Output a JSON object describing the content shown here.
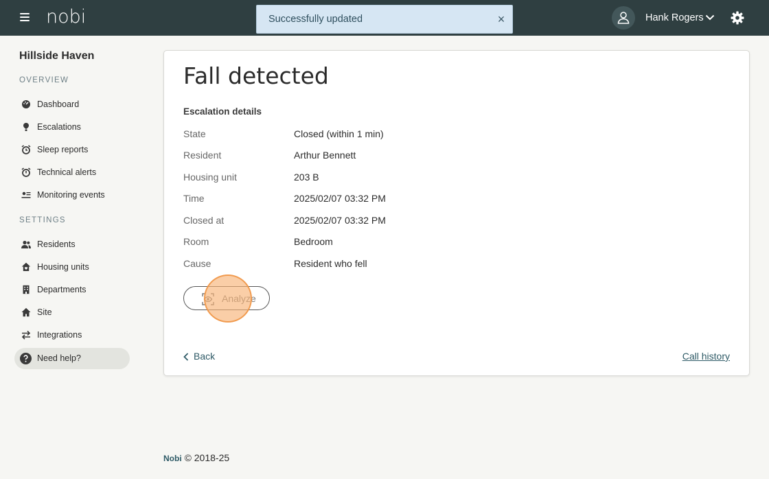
{
  "header": {
    "logo_text": "nobi",
    "toast": {
      "message": "Successfully updated",
      "close_symbol": "×"
    },
    "user": {
      "name": "Hank Rogers"
    },
    "icons": [
      "menu-icon",
      "user-icon",
      "chevron-down-icon",
      "gear-icon"
    ]
  },
  "sidebar": {
    "site_name": "Hillside Haven",
    "overview_label": "OVERVIEW",
    "settings_label": "SETTINGS",
    "overview_items": [
      {
        "label": "Dashboard",
        "icon": "dashboard-icon"
      },
      {
        "label": "Escalations",
        "icon": "escalation-icon"
      },
      {
        "label": "Sleep reports",
        "icon": "alarm-clock-icon"
      },
      {
        "label": "Technical alerts",
        "icon": "alarm-icon"
      },
      {
        "label": "Monitoring events",
        "icon": "events-icon"
      }
    ],
    "settings_items": [
      {
        "label": "Residents",
        "icon": "residents-icon"
      },
      {
        "label": "Housing units",
        "icon": "house-heart-icon"
      },
      {
        "label": "Departments",
        "icon": "building-icon"
      },
      {
        "label": "Site",
        "icon": "home-icon"
      },
      {
        "label": "Integrations",
        "icon": "arrows-exchange-icon"
      }
    ],
    "help": {
      "label": "Need help?",
      "icon": "question-icon"
    }
  },
  "main": {
    "title": "Fall detected",
    "section_title": "Escalation details",
    "details": [
      {
        "key": "State",
        "value": "Closed (within 1 min)"
      },
      {
        "key": "Resident",
        "value": "Arthur Bennett"
      },
      {
        "key": "Housing unit",
        "value": "203 B"
      },
      {
        "key": "Time",
        "value": "2025/02/07 03:32 PM"
      },
      {
        "key": "Closed at",
        "value": "2025/02/07 03:32 PM"
      },
      {
        "key": "Room",
        "value": "Bedroom"
      },
      {
        "key": "Cause",
        "value": "Resident who fell"
      }
    ],
    "analyze_label": "Analyze",
    "back_label": "Back",
    "call_history_label": "Call history"
  },
  "footer": {
    "brand": "Nobi",
    "copyright": "© 2018-25"
  },
  "colors": {
    "topbar": "#2f3f41",
    "accent": "#2e5a66",
    "toast_bg": "#d6e6f3",
    "click_indicator": "#f8b478"
  }
}
